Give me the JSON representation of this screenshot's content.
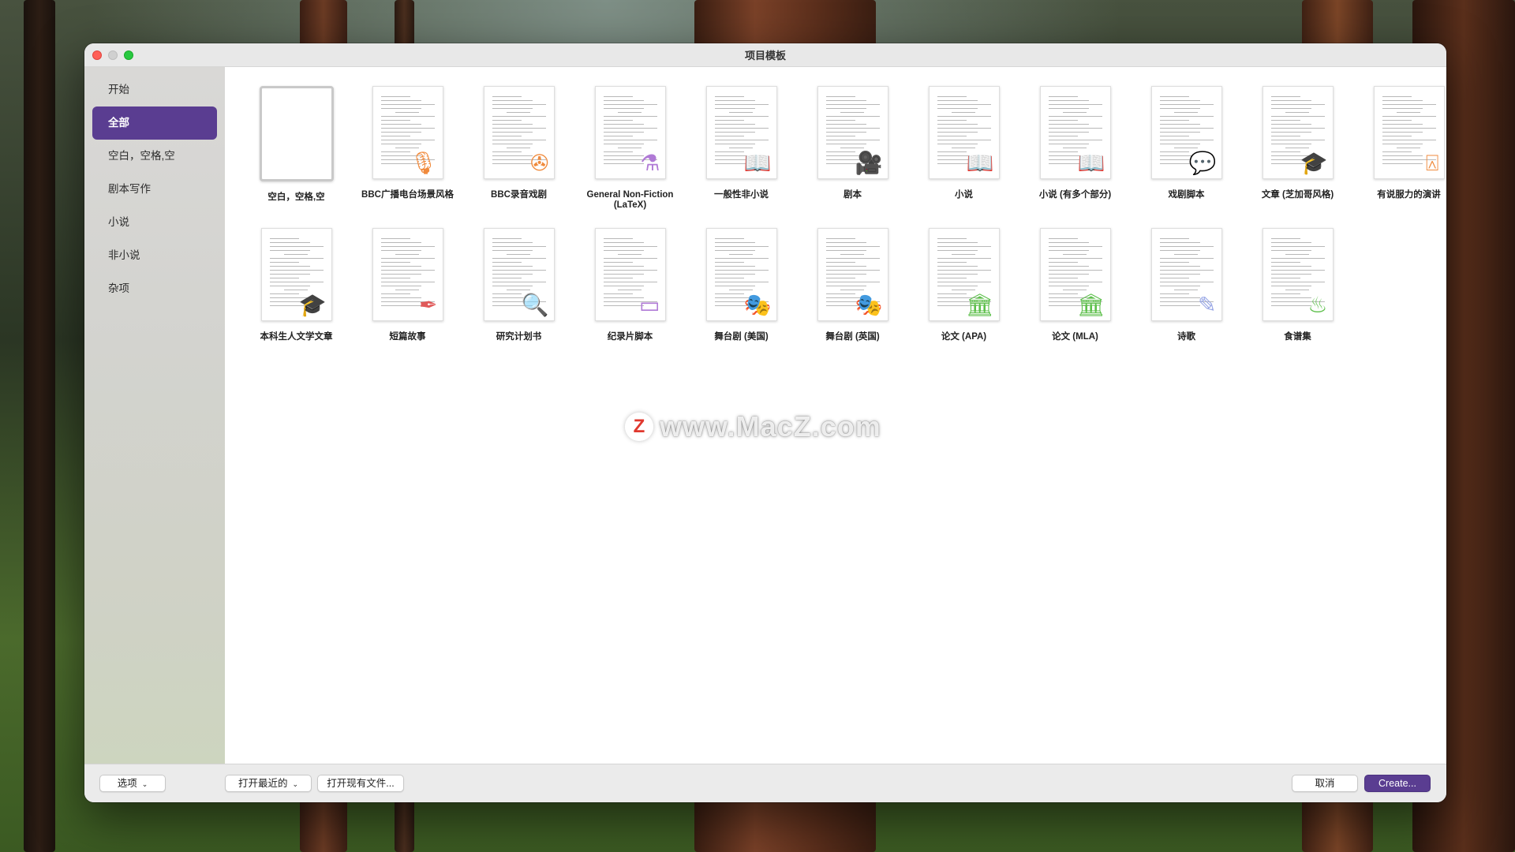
{
  "window": {
    "title": "项目模板"
  },
  "sidebar": {
    "items": [
      {
        "label": "开始",
        "active": false
      },
      {
        "label": "全部",
        "active": true
      },
      {
        "label": "空白，空格,空",
        "active": false
      },
      {
        "label": "剧本写作",
        "active": false
      },
      {
        "label": "小说",
        "active": false
      },
      {
        "label": "非小说",
        "active": false
      },
      {
        "label": "杂项",
        "active": false
      }
    ]
  },
  "templates": [
    {
      "label": "空白，空格,空",
      "icon": "blank",
      "selected": true
    },
    {
      "label": "BBC广播电台场景风格",
      "icon": "microphone-icon",
      "color": "#f08a3c"
    },
    {
      "label": "BBC录音戏剧",
      "icon": "film-reel-icon",
      "color": "#f08a3c"
    },
    {
      "label": "General Non-Fiction (LaTeX)",
      "icon": "flask-icon",
      "color": "#b07ad6"
    },
    {
      "label": "一般性非小说",
      "icon": "book-icon",
      "color": "#3fa9e8"
    },
    {
      "label": "剧本",
      "icon": "movie-camera-icon",
      "color": "#5cbf4a"
    },
    {
      "label": "小说",
      "icon": "book-icon",
      "color": "#3fa9e8"
    },
    {
      "label": "小说 (有多个部分)",
      "icon": "book-icon",
      "color": "#3fa9e8"
    },
    {
      "label": "戏剧脚本",
      "icon": "speech-bubble-icon",
      "color": "#f2c230"
    },
    {
      "label": "文章 (芝加哥风格)",
      "icon": "graduation-cap-icon",
      "color": "#7c8fe0"
    },
    {
      "label": "有说服力的演讲",
      "icon": "lectern-icon",
      "color": "#f08a3c"
    },
    {
      "label": "本科生人文学文章",
      "icon": "graduation-cap-icon",
      "color": "#7c8fe0"
    },
    {
      "label": "短篇故事",
      "icon": "fountain-pen-icon",
      "color": "#e05a5a"
    },
    {
      "label": "研究计划书",
      "icon": "magnifier-icon",
      "color": "#f08a3c"
    },
    {
      "label": "纪录片脚本",
      "icon": "monitor-icon",
      "color": "#b07ad6"
    },
    {
      "label": "舞台剧 (美国)",
      "icon": "theater-masks-icon",
      "color": "#3fa9e8"
    },
    {
      "label": "舞台剧 (英国)",
      "icon": "theater-masks-icon",
      "color": "#3fa9e8"
    },
    {
      "label": "论文 (APA)",
      "icon": "institution-icon",
      "color": "#5cbf4a"
    },
    {
      "label": "论文 (MLA)",
      "icon": "institution-icon",
      "color": "#5cbf4a"
    },
    {
      "label": "诗歌",
      "icon": "feather-icon",
      "color": "#9aa8e6"
    },
    {
      "label": "食谱集",
      "icon": "chef-hat-icon",
      "color": "#5cbf4a"
    }
  ],
  "watermark": {
    "logo": "Z",
    "text": "www.MacZ.com"
  },
  "bottombar": {
    "options_label": "选项",
    "open_recent_label": "打开最近的",
    "open_existing_label": "打开现有文件...",
    "cancel_label": "取消",
    "create_label": "Create..."
  },
  "accent_color": "#5a3d91"
}
